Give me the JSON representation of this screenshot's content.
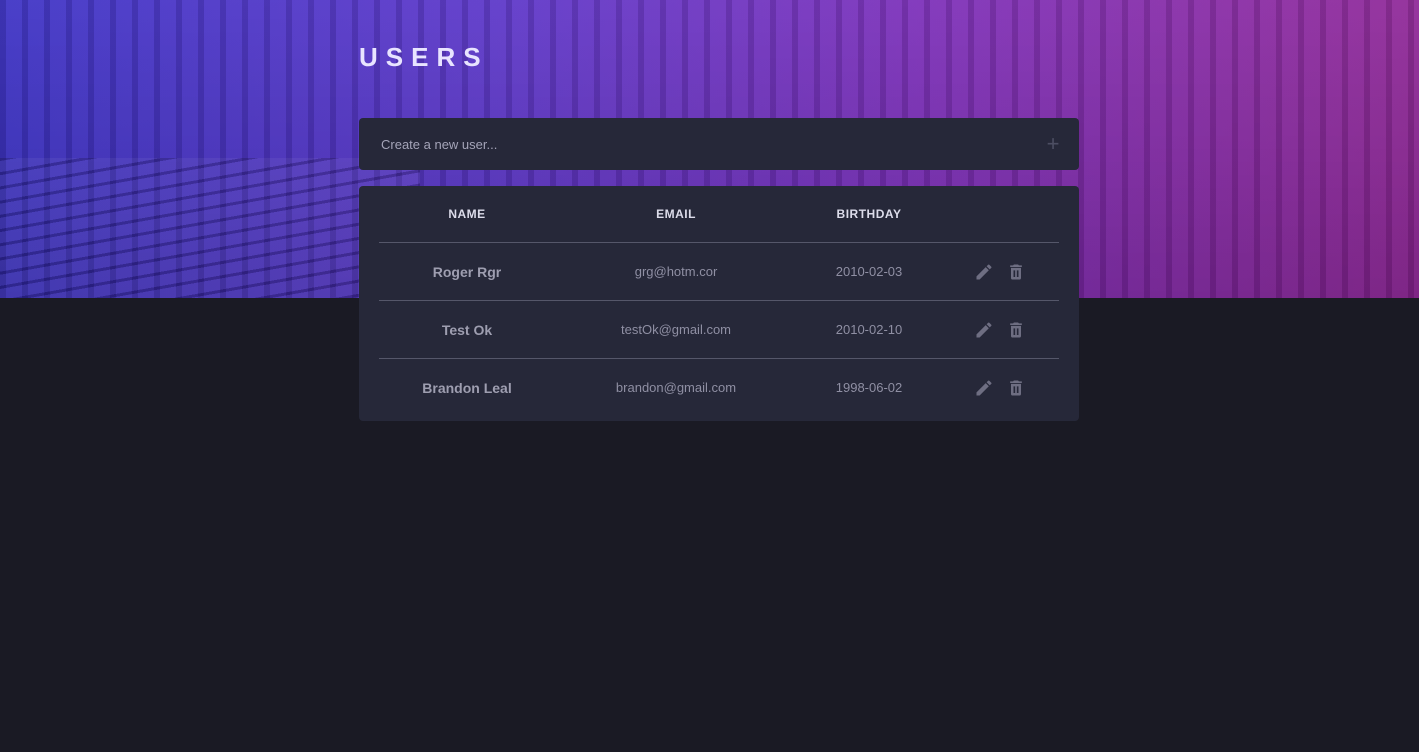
{
  "page": {
    "title": "USERS"
  },
  "create": {
    "placeholder": "Create a new user...",
    "add_icon": "plus-icon"
  },
  "table": {
    "columns": [
      "NAME",
      "EMAIL",
      "BIRTHDAY"
    ],
    "rows": [
      {
        "name": "Roger Rgr",
        "email": "grg@hotm.cor",
        "birthday": "2010-02-03"
      },
      {
        "name": "Test Ok",
        "email": "testOk@gmail.com",
        "birthday": "2010-02-10"
      },
      {
        "name": "Brandon Leal",
        "email": "brandon@gmail.com",
        "birthday": "1998-06-02"
      }
    ],
    "row_actions": [
      "pencil-icon",
      "trash-icon"
    ]
  },
  "colors": {
    "background": "#1a1a24",
    "card": "#262839",
    "hero_start": "#3a2fc4",
    "hero_end": "#8e2596"
  }
}
